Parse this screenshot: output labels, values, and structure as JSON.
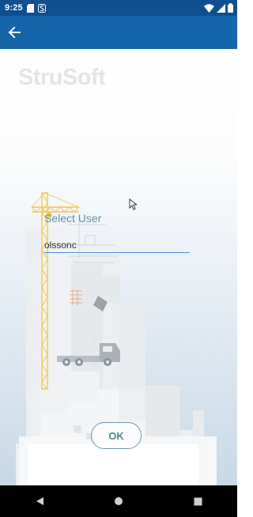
{
  "status_bar": {
    "time": "9:25",
    "left_icons": [
      "sd-card-icon",
      "s-notification-icon"
    ],
    "right_icons": [
      "wifi-icon",
      "signal-icon",
      "battery-icon"
    ]
  },
  "app_bar": {
    "color": "#1565a9",
    "back_icon": "arrow-left-icon"
  },
  "main": {
    "logo_text": "StruSoft",
    "select_user_label": "Select User",
    "user_input_value": "olssonc",
    "ok_label": "OK"
  },
  "nav_bar": {
    "buttons": [
      "back-triangle-icon",
      "home-circle-icon",
      "recents-square-icon"
    ]
  },
  "colors": {
    "status_bar": "#0f4f8f",
    "input_underline": "#4a8fd8",
    "label_text": "#5f93a8",
    "crane": "#f4c64f"
  }
}
